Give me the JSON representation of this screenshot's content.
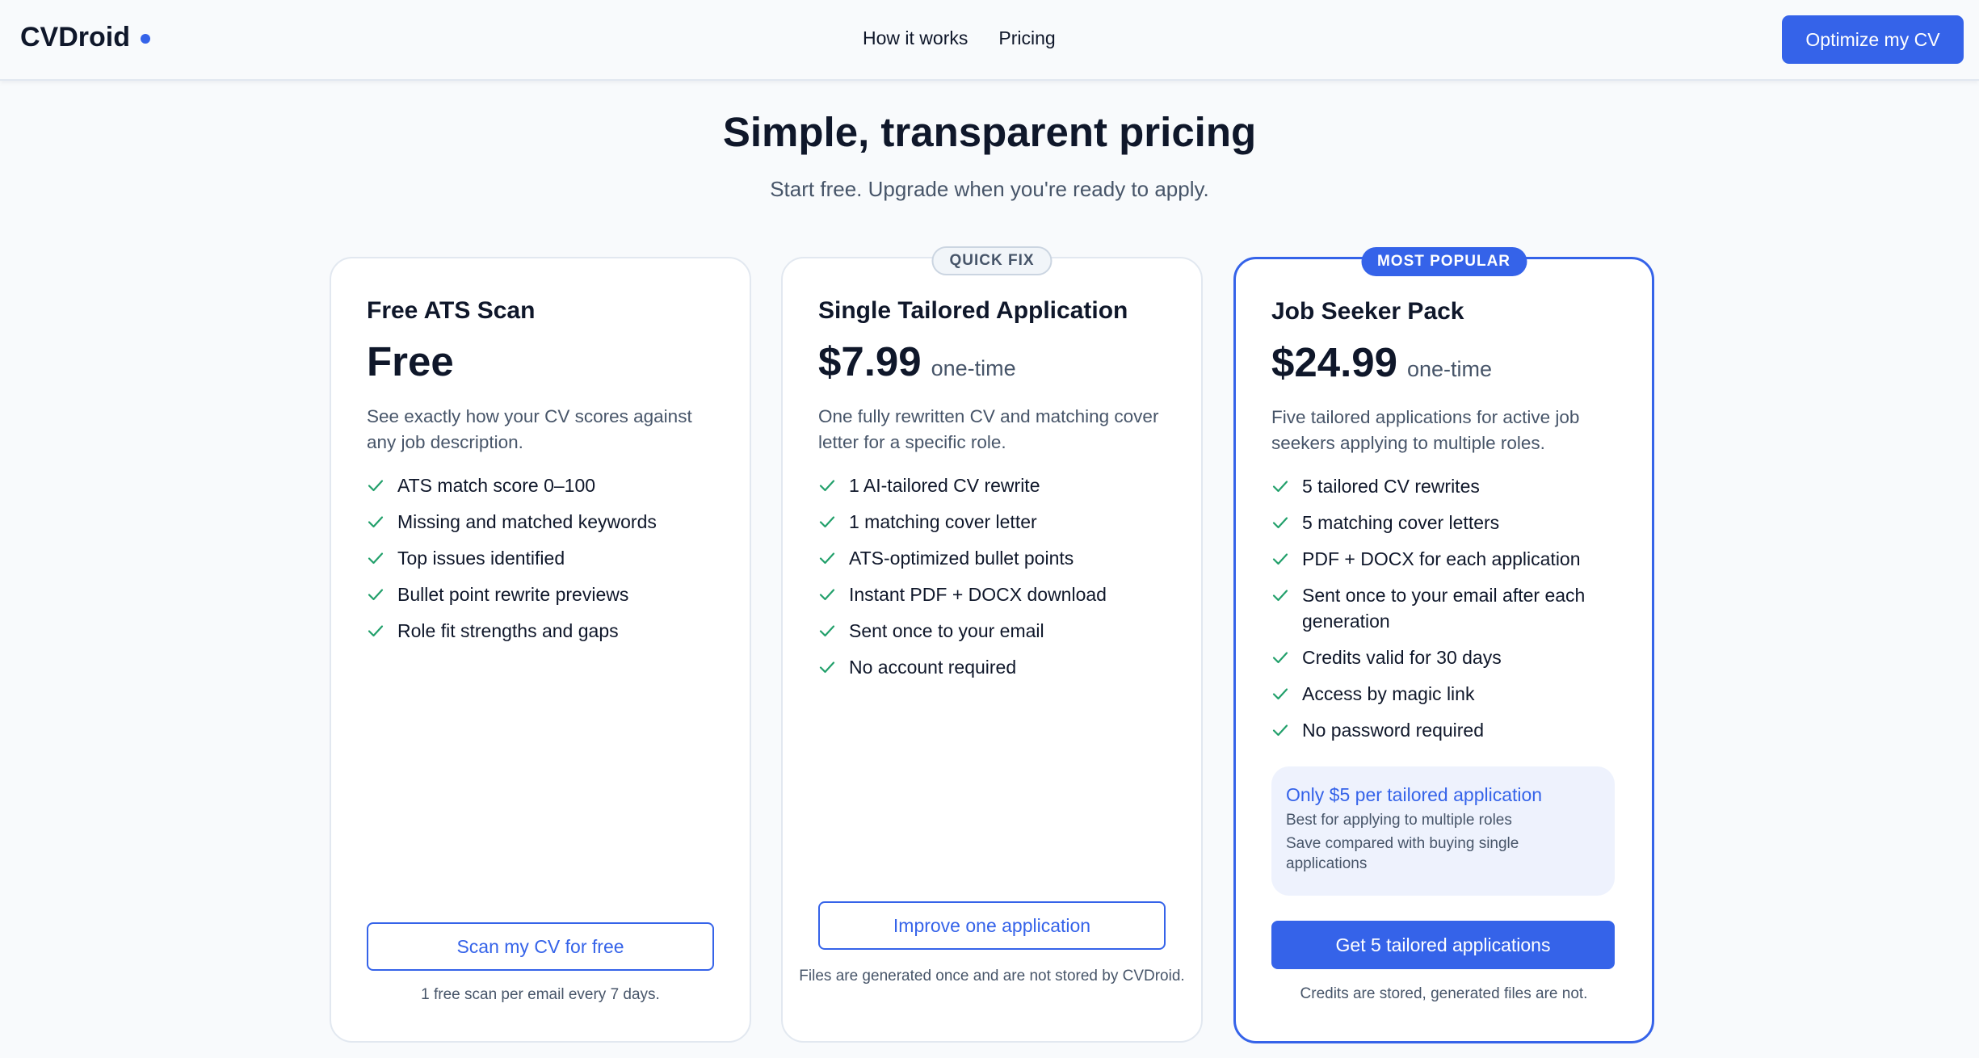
{
  "brand": {
    "name": "CVDroid",
    "dot_color": "#3563e9"
  },
  "nav": {
    "links": [
      "How it works",
      "Pricing"
    ],
    "cta_label": "Optimize my CV"
  },
  "hero": {
    "title": "Simple, transparent pricing",
    "subtitle": "Start free. Upgrade when you're ready to apply."
  },
  "colors": {
    "accent": "#3563e9",
    "check": "#22a06b",
    "muted_text": "#475569"
  },
  "plans": [
    {
      "badge": "",
      "title": "Free ATS Scan",
      "price": "Free",
      "price_unit": "",
      "description": "See exactly how your CV scores against any job description.",
      "features": [
        "ATS match score 0–100",
        "Missing and matched keywords",
        "Top issues identified",
        "Bullet point rewrite previews",
        "Role fit strengths and gaps"
      ],
      "button_label": "Scan my CV for free",
      "note": "1 free scan per email every 7 days."
    },
    {
      "badge": "QUICK FIX",
      "title": "Single Tailored Application",
      "price": "$7.99",
      "price_unit": "one-time",
      "description": "One fully rewritten CV and matching cover letter for a specific role.",
      "features": [
        "1 AI-tailored CV rewrite",
        "1 matching cover letter",
        "ATS-optimized bullet points",
        "Instant PDF + DOCX download",
        "Sent once to your email",
        "No account required"
      ],
      "button_label": "Improve one application",
      "note": "Files are generated once and are not stored by CVDroid."
    },
    {
      "badge": "MOST POPULAR",
      "title": "Job Seeker Pack",
      "price": "$24.99",
      "price_unit": "one-time",
      "description": "Five tailored applications for active job seekers applying to multiple roles.",
      "features": [
        "5 tailored CV rewrites",
        "5 matching cover letters",
        "PDF + DOCX for each application",
        "Sent once to your email after each generation",
        "Credits valid for 30 days",
        "Access by magic link",
        "No password required"
      ],
      "promo": {
        "title": "Only $5 per tailored application",
        "line1": "Best for applying to multiple roles",
        "line2": "Save compared with buying single applications"
      },
      "button_label": "Get 5 tailored applications",
      "note": "Credits are stored, generated files are not."
    }
  ]
}
